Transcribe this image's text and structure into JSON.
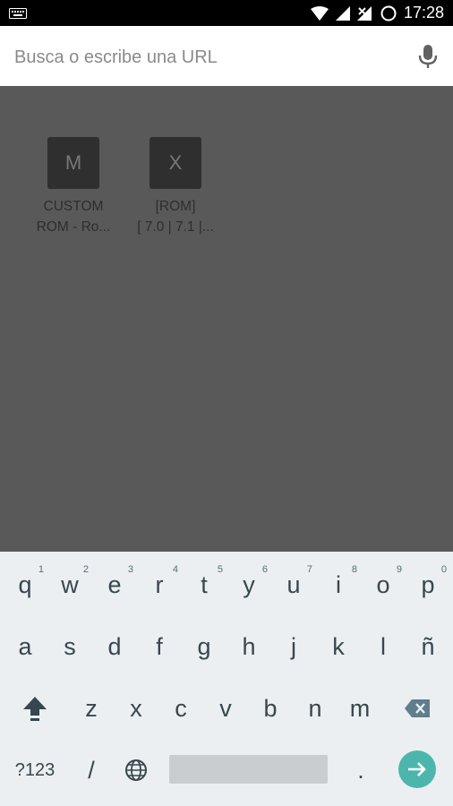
{
  "status_bar": {
    "time": "17:28",
    "icons": [
      "keyboard-icon",
      "wifi-icon",
      "cell-signal-icon",
      "no-signal-icon",
      "battery-charging-icon"
    ]
  },
  "omnibox": {
    "placeholder": "Busca o escribe una URL",
    "value": "",
    "mic_icon": "mic-icon"
  },
  "tiles": [
    {
      "letter": "M",
      "title": "CUSTOM\nROM - Ro..."
    },
    {
      "letter": "X",
      "title": "[ROM]\n[ 7.0 | 7.1 |..."
    }
  ],
  "keyboard": {
    "row1": [
      {
        "k": "q",
        "n": "1"
      },
      {
        "k": "w",
        "n": "2"
      },
      {
        "k": "e",
        "n": "3"
      },
      {
        "k": "r",
        "n": "4"
      },
      {
        "k": "t",
        "n": "5"
      },
      {
        "k": "y",
        "n": "6"
      },
      {
        "k": "u",
        "n": "7"
      },
      {
        "k": "i",
        "n": "8"
      },
      {
        "k": "o",
        "n": "9"
      },
      {
        "k": "p",
        "n": "0"
      }
    ],
    "row2": [
      "a",
      "s",
      "d",
      "f",
      "g",
      "h",
      "j",
      "k",
      "l",
      "ñ"
    ],
    "row3": [
      "z",
      "x",
      "c",
      "v",
      "b",
      "n",
      "m"
    ],
    "symbols_label": "?123",
    "slash": "/",
    "period": ".",
    "globe_icon": "globe-icon",
    "shift_icon": "shift-icon",
    "backspace_icon": "backspace-icon",
    "enter_icon": "arrow-right-icon",
    "accent_color": "#4db6ac"
  },
  "colors": {
    "status_bar": "#000000",
    "content_bg": "#595959",
    "keyboard_bg": "#eceff1"
  }
}
